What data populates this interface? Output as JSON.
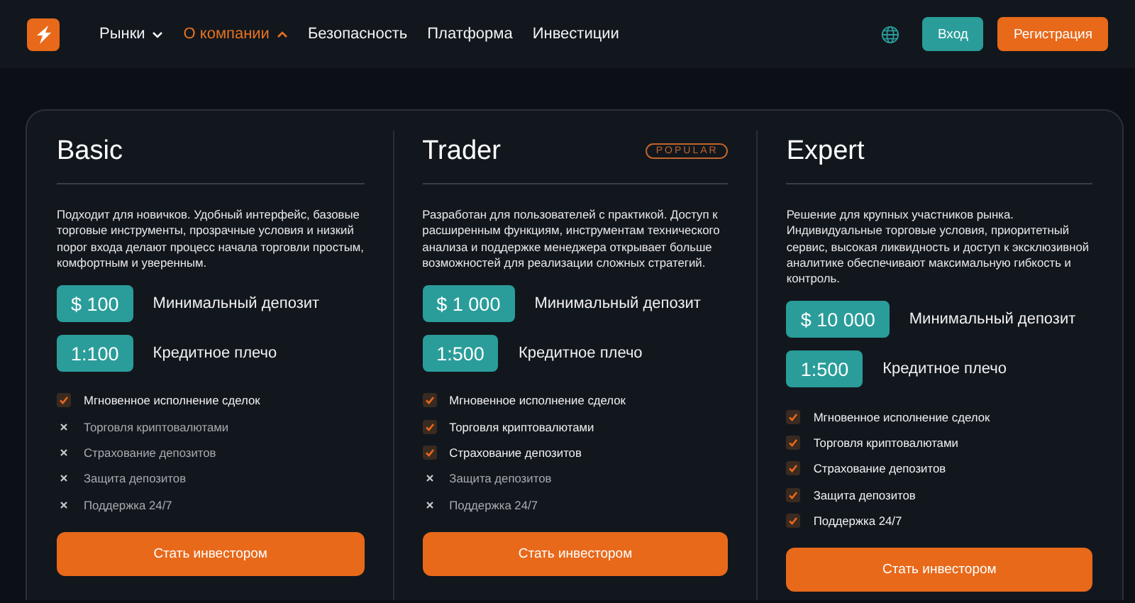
{
  "nav": {
    "items": [
      {
        "label": "Рынки",
        "kind": "dropdown",
        "selected": false,
        "expanded": false
      },
      {
        "label": "О компании",
        "kind": "dropdown",
        "selected": true,
        "expanded": true
      },
      {
        "label": "Безопасность",
        "kind": "link",
        "selected": false
      },
      {
        "label": "Платформа",
        "kind": "link",
        "selected": false
      },
      {
        "label": "Инвестиции",
        "kind": "link",
        "selected": false
      }
    ],
    "login": "Вход",
    "register": "Регистрация"
  },
  "plans": [
    {
      "name": "Basic",
      "description": "Подходит для новичков. Удобный интерфейс, базовые торговые инструменты, прозрачные условия и низкий порог входа делают процесс начала торговли простым, комфортным и уверенным.",
      "deposit": "$ 100",
      "deposit_label": "Минимальный депозит",
      "leverage": "1:100",
      "leverage_label": "Кредитное плечо",
      "features": [
        {
          "label": "Мгновенное исполнение сделок",
          "checked": true
        },
        {
          "label": "Торговля криптовалютами",
          "checked": false
        },
        {
          "label": "Страхование депозитов",
          "checked": false
        },
        {
          "label": "Защита депозитов",
          "checked": false
        },
        {
          "label": "Поддержка 24/7",
          "checked": false
        }
      ],
      "button": "Стать инвестором"
    },
    {
      "name": "Trader",
      "badge": "POPULAR",
      "description": "Разработан для пользователей с практикой. Доступ к расширенным функциям, инструментам технического анализа и поддержке менеджера открывает больше возможностей для реализации сложных стратегий.",
      "deposit": "$ 1 000",
      "deposit_label": "Минимальный депозит",
      "leverage": "1:500",
      "leverage_label": "Кредитное плечо",
      "features": [
        {
          "label": "Мгновенное исполнение сделок",
          "checked": true
        },
        {
          "label": "Торговля криптовалютами",
          "checked": true
        },
        {
          "label": "Страхование депозитов",
          "checked": true
        },
        {
          "label": "Защита депозитов",
          "checked": false
        },
        {
          "label": "Поддержка 24/7",
          "checked": false
        }
      ],
      "button": "Стать инвестором"
    },
    {
      "name": "Expert",
      "description": "Решение для крупных участников рынка. Индивидуальные торговые условия, приоритетный сервис, высокая ликвидность и доступ к эксклюзивной аналитике обеспечивают максимальную гибкость и контроль.",
      "deposit": "$ 10 000",
      "deposit_label": "Минимальный депозит",
      "leverage": "1:500",
      "leverage_label": "Кредитное плечо",
      "features": [
        {
          "label": "Мгновенное исполнение сделок",
          "checked": true
        },
        {
          "label": "Торговля криптовалютами",
          "checked": true
        },
        {
          "label": "Страхование депозитов",
          "checked": true
        },
        {
          "label": "Защита депозитов",
          "checked": true
        },
        {
          "label": "Поддержка 24/7",
          "checked": true
        }
      ],
      "button": "Стать инвестором"
    }
  ]
}
